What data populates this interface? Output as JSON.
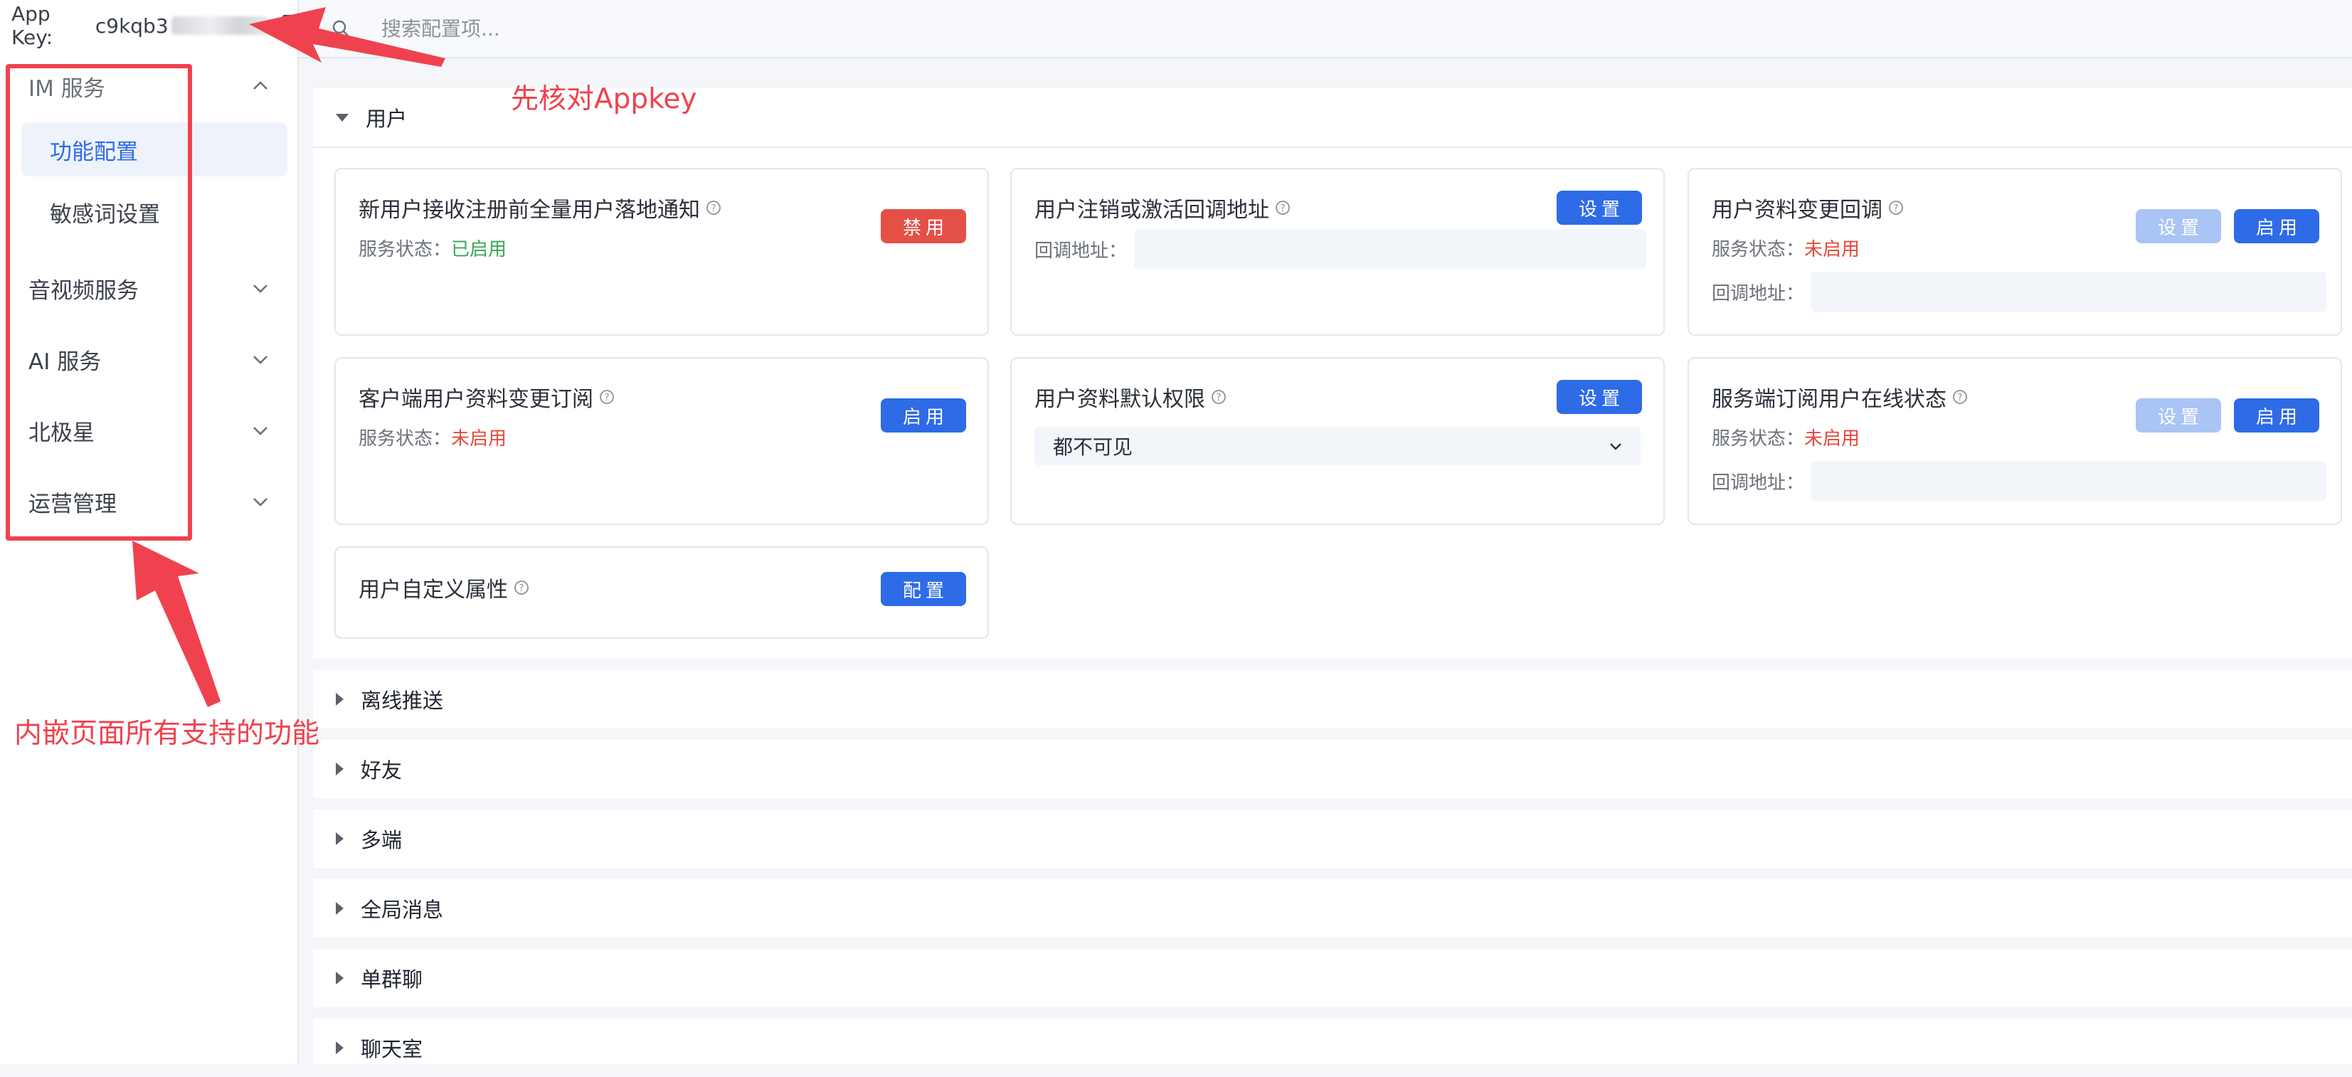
{
  "sidebar": {
    "app_key_label": "App Key:",
    "app_key_value": "c9kqb3",
    "groups": [
      {
        "label": "IM 服务",
        "expanded": true,
        "items": [
          {
            "label": "功能配置",
            "active": true
          },
          {
            "label": "敏感词设置",
            "active": false
          }
        ]
      },
      {
        "label": "音视频服务",
        "expanded": false
      },
      {
        "label": "AI 服务",
        "expanded": false
      },
      {
        "label": "北极星",
        "expanded": false
      },
      {
        "label": "运营管理",
        "expanded": false
      }
    ]
  },
  "search": {
    "placeholder": "搜索配置项..."
  },
  "user_section": {
    "title": "用户",
    "cards": [
      {
        "title": "新用户接收注册前全量用户落地通知",
        "status_label": "服务状态：",
        "status_value": "已启用",
        "button": "禁用"
      },
      {
        "title": "用户注销或激活回调地址",
        "callback_label": "回调地址：",
        "button": "设置"
      },
      {
        "title": "用户资料变更回调",
        "status_label": "服务状态：",
        "status_value": "未启用",
        "callback_label": "回调地址：",
        "button_set": "设置",
        "button_enable": "启用"
      },
      {
        "title": "客户端用户资料变更订阅",
        "status_label": "服务状态：",
        "status_value": "未启用",
        "button": "启用"
      },
      {
        "title": "用户资料默认权限",
        "select_value": "都不可见",
        "button": "设置"
      },
      {
        "title": "服务端订阅用户在线状态",
        "status_label": "服务状态：",
        "status_value": "未启用",
        "callback_label": "回调地址：",
        "button_set": "设置",
        "button_enable": "启用"
      },
      {
        "title": "用户自定义属性",
        "button": "配置"
      }
    ]
  },
  "collapsed_sections": [
    "离线推送",
    "好友",
    "多端",
    "全局消息",
    "单群聊",
    "聊天室"
  ],
  "annotations": {
    "appkey_note": "先核对Appkey",
    "menu_note": "内嵌页面所有支持的功能"
  },
  "colors": {
    "accent": "#2e6be6",
    "danger": "#e55046",
    "enabled": "#3aa757",
    "disabled_status": "#e5483c",
    "annotation": "#f0424e"
  }
}
